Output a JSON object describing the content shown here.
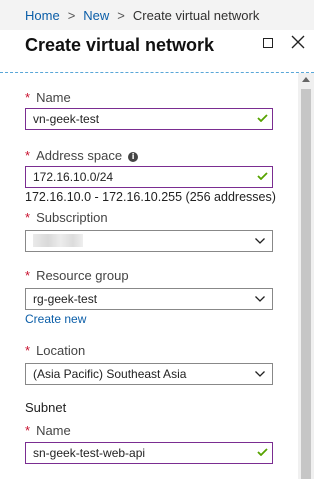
{
  "breadcrumb": {
    "items": [
      "Home",
      "New"
    ],
    "current": "Create virtual network",
    "separator": ">"
  },
  "panel": {
    "title": "Create virtual network"
  },
  "form": {
    "name": {
      "label": "Name",
      "required_mark": "*",
      "value": "vn-geek-test"
    },
    "address_space": {
      "label": "Address space",
      "required_mark": "*",
      "info_icon": "i",
      "value": "172.16.10.0/24",
      "range_text": "172.16.10.0 - 172.16.10.255 (256 addresses)"
    },
    "subscription": {
      "label": "Subscription",
      "required_mark": "*",
      "value": ""
    },
    "resource_group": {
      "label": "Resource group",
      "required_mark": "*",
      "value": "rg-geek-test",
      "create_new": "Create new"
    },
    "location": {
      "label": "Location",
      "required_mark": "*",
      "value": "(Asia Pacific) Southeast Asia"
    },
    "subnet": {
      "heading": "Subnet",
      "name": {
        "label": "Name",
        "required_mark": "*",
        "value": "sn-geek-test-web-api"
      }
    }
  },
  "colors": {
    "link": "#0b5ea8",
    "required": "#c8102e",
    "valid_border": "#7a2d91",
    "valid_check": "#57a300",
    "dashed_divider": "#59a7d8"
  },
  "icons": [
    "chevron-right-icon",
    "restore-icon",
    "close-icon",
    "info-icon",
    "check-icon",
    "chevron-down-icon"
  ]
}
